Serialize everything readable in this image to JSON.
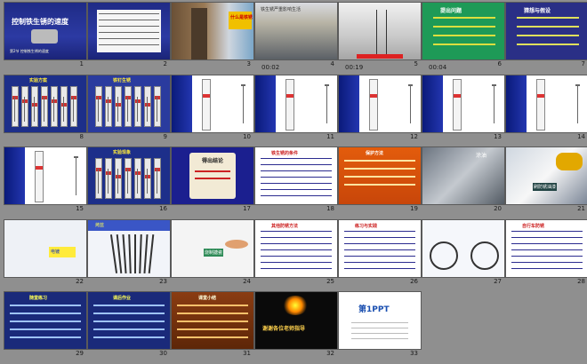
{
  "slides": [
    {
      "n": "1",
      "dur": "",
      "theme": "title",
      "text": "控制铁生锈的速度",
      "subtitle": "第2节 控制铁生锈的速度"
    },
    {
      "n": "2",
      "dur": "",
      "theme": "table",
      "text": ""
    },
    {
      "n": "3",
      "dur": "",
      "theme": "photo-rust",
      "text": "什么是铁锈"
    },
    {
      "n": "4",
      "dur": "00:02",
      "theme": "photo-water",
      "text": "铁生锈严重影响生活"
    },
    {
      "n": "5",
      "dur": "00:19",
      "theme": "photo-tower",
      "text": ""
    },
    {
      "n": "6",
      "dur": "00:04",
      "theme": "question",
      "text": "提出问题"
    },
    {
      "n": "7",
      "dur": "",
      "theme": "question2",
      "text": "猜想与假设"
    },
    {
      "n": "8",
      "dur": "",
      "theme": "tubes-blue",
      "text": "实验方案"
    },
    {
      "n": "9",
      "dur": "",
      "theme": "tubes-blue2",
      "text": "铁钉生锈"
    },
    {
      "n": "10",
      "dur": "",
      "theme": "nail",
      "text": ""
    },
    {
      "n": "11",
      "dur": "",
      "theme": "nail",
      "text": ""
    },
    {
      "n": "12",
      "dur": "",
      "theme": "nail",
      "text": ""
    },
    {
      "n": "13",
      "dur": "",
      "theme": "nail",
      "text": ""
    },
    {
      "n": "14",
      "dur": "",
      "theme": "nail",
      "text": ""
    },
    {
      "n": "15",
      "dur": "",
      "theme": "nail",
      "text": ""
    },
    {
      "n": "16",
      "dur": "",
      "theme": "tubes-blue",
      "text": "实验现象"
    },
    {
      "n": "17",
      "dur": "",
      "theme": "scroll",
      "text": "得出结论"
    },
    {
      "n": "18",
      "dur": "",
      "theme": "text-white",
      "text": "铁生锈的条件"
    },
    {
      "n": "19",
      "dur": "",
      "theme": "orange",
      "text": "保护方法"
    },
    {
      "n": "20",
      "dur": "",
      "theme": "photo-engine",
      "text": "涂油"
    },
    {
      "n": "21",
      "dur": "",
      "theme": "photo-moto",
      "text": "刷防锈油漆"
    },
    {
      "n": "22",
      "dur": "",
      "theme": "tools",
      "text": "电镀"
    },
    {
      "n": "23",
      "dur": "",
      "theme": "nails",
      "text": "烤蓝"
    },
    {
      "n": "24",
      "dur": "",
      "theme": "pottery",
      "text": "烧制搪瓷"
    },
    {
      "n": "25",
      "dur": "",
      "theme": "text-white",
      "text": "其他防锈方法"
    },
    {
      "n": "26",
      "dur": "",
      "theme": "text-white",
      "text": "练习与实践"
    },
    {
      "n": "27",
      "dur": "",
      "theme": "bike",
      "text": ""
    },
    {
      "n": "28",
      "dur": "",
      "theme": "text-white",
      "text": "自行车防锈"
    },
    {
      "n": "29",
      "dur": "",
      "theme": "navy-text",
      "text": "随堂练习"
    },
    {
      "n": "30",
      "dur": "",
      "theme": "navy-text",
      "text": "课后作业"
    },
    {
      "n": "31",
      "dur": "",
      "theme": "brown",
      "text": "课堂小结"
    },
    {
      "n": "32",
      "dur": "",
      "theme": "fireworks",
      "text": "谢谢各位老师指导"
    },
    {
      "n": "33",
      "dur": "",
      "theme": "ppt",
      "text": "第1PPT"
    }
  ]
}
